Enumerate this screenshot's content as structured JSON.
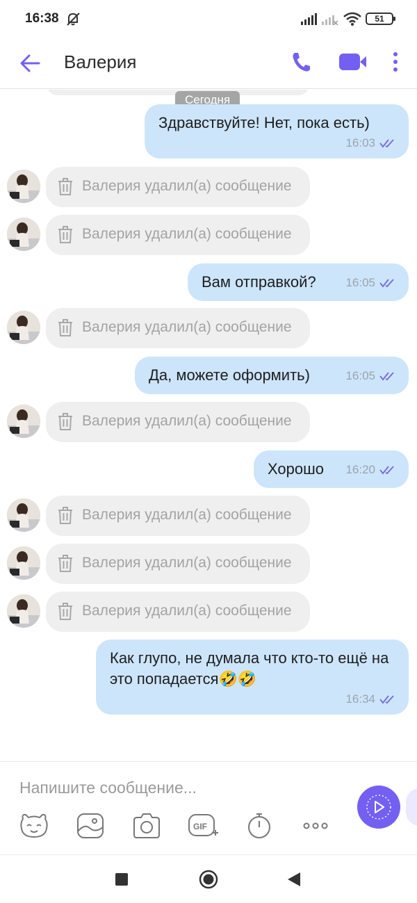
{
  "status_bar": {
    "time": "16:38",
    "battery": "51",
    "icons": [
      "mute-icon",
      "signal-icon",
      "signal-icon",
      "wifi-icon",
      "battery-icon"
    ]
  },
  "header": {
    "contact_name": "Валерия",
    "icons": [
      "back-arrow-icon",
      "phone-icon",
      "video-camera-icon",
      "more-vertical-icon"
    ],
    "accent_color": "#7360f2"
  },
  "chat": {
    "date_chip": "Сегодня",
    "deleted_text": "Валерия удалил(а) сообщение",
    "messages": [
      {
        "type": "outgoing",
        "text": "Здравствуйте! Нет, пока есть)",
        "time": "16:03"
      },
      {
        "type": "deleted"
      },
      {
        "type": "deleted"
      },
      {
        "type": "outgoing",
        "text": "Вам отправкой?",
        "time": "16:05"
      },
      {
        "type": "deleted"
      },
      {
        "type": "outgoing",
        "text": "Да, можете оформить)",
        "time": "16:05"
      },
      {
        "type": "deleted"
      },
      {
        "type": "outgoing",
        "text": "Хорошо",
        "time": "16:20"
      },
      {
        "type": "deleted"
      },
      {
        "type": "deleted"
      },
      {
        "type": "deleted"
      },
      {
        "type": "outgoing",
        "text": "Как глупо, не думала что кто-то ещё на это попадается🤣🤣",
        "time": "16:34"
      }
    ],
    "outgoing_bubble_color": "#cde5fb",
    "deleted_bubble_color": "#efefef"
  },
  "composer": {
    "placeholder": "Напишите сообщение...",
    "tools": [
      "sticker-icon",
      "gallery-icon",
      "camera-icon",
      "gif-icon",
      "timer-icon",
      "more-horizontal-icon"
    ],
    "send_icon": "send-icon"
  },
  "navbar": {
    "icons": [
      "recents-icon",
      "home-icon",
      "back-icon"
    ]
  }
}
